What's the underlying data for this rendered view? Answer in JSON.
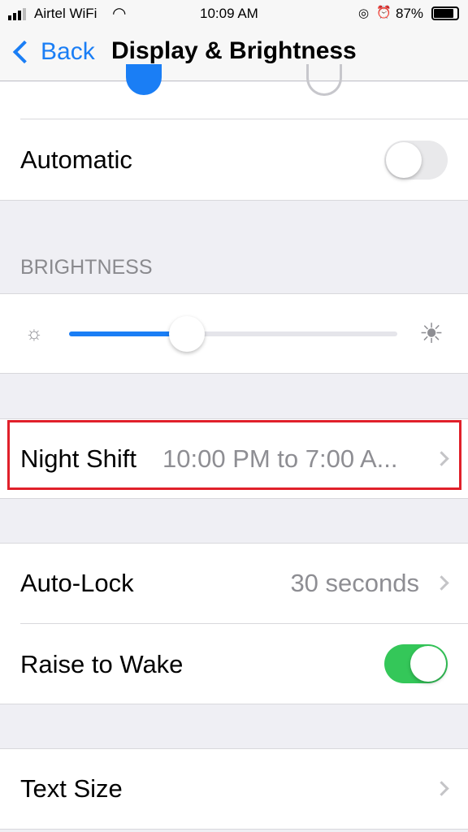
{
  "status_bar": {
    "carrier": "Airtel WiFi",
    "time": "10:09 AM",
    "battery": "87%"
  },
  "nav": {
    "back_label": "Back",
    "title": "Display & Brightness"
  },
  "appearance": {
    "selected": "light"
  },
  "automatic": {
    "label": "Automatic",
    "on": false
  },
  "brightness": {
    "header": "BRIGHTNESS",
    "level": 0.36
  },
  "night_shift": {
    "label": "Night Shift",
    "value": "10:00 PM to 7:00 A..."
  },
  "auto_lock": {
    "label": "Auto-Lock",
    "value": "30 seconds"
  },
  "raise_to_wake": {
    "label": "Raise to Wake",
    "on": true
  },
  "text_size": {
    "label": "Text Size"
  },
  "colors": {
    "accent": "#1a7ef5",
    "toggle_on": "#34c759",
    "highlight": "#e0202a"
  }
}
